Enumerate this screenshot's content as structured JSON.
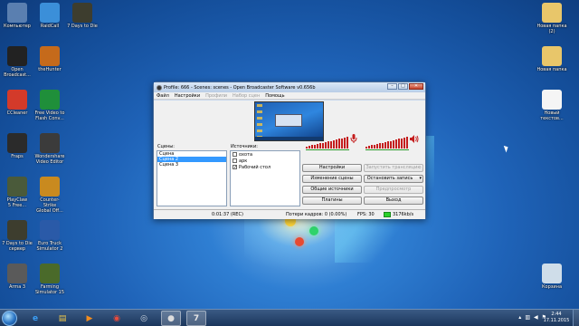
{
  "desktop": {
    "left_icons": [
      {
        "label": "Компьютер",
        "icon": "computer-icon",
        "color": "#5a7fb0"
      },
      {
        "label": "RaidCall",
        "icon": "raidcall-icon",
        "color": "#3b8fd9"
      },
      {
        "label": "7 Days to Die",
        "icon": "7days-icon",
        "color": "#3d3d2e"
      },
      {
        "label": "Open\nBroadcast...",
        "icon": "obs-icon",
        "color": "#222222"
      },
      {
        "label": "theHunter",
        "icon": "thehunter-icon",
        "color": "#c56a1b"
      },
      {
        "label": "CCleaner",
        "icon": "ccleaner-icon",
        "color": "#d33a2a"
      },
      {
        "label": "Free Video to\nFlash Conv...",
        "icon": "flash-converter-icon",
        "color": "#1f8f3a"
      },
      {
        "label": "Fraps",
        "icon": "fraps-icon",
        "color": "#2b2b2b"
      },
      {
        "label": "Wondershare\nVideo Editor",
        "icon": "wondershare-icon",
        "color": "#3b3b3b"
      },
      {
        "label": "PlayClaw\n5 Free...",
        "icon": "playclaw-icon",
        "color": "#4a5a3a"
      },
      {
        "label": "Counter-Strike\nGlobal Off...",
        "icon": "csgo-icon",
        "color": "#c98a1f"
      },
      {
        "label": "7 Days to Die\nсервер",
        "icon": "7days-server-icon",
        "color": "#3d3d2e"
      },
      {
        "label": "Euro Truck\nSimulator 2",
        "icon": "euro-truck-icon",
        "color": "#2a5aa8"
      },
      {
        "label": "Arma 3",
        "icon": "arma3-icon",
        "color": "#5a5a5a"
      },
      {
        "label": "Farming\nSimulator 15",
        "icon": "farming-icon",
        "color": "#4a6a2a"
      }
    ],
    "right_icons": [
      {
        "label": "Новая папка\n(2)",
        "icon": "folder-icon",
        "color": "#e8c66a"
      },
      {
        "label": "Новая папка",
        "icon": "folder-icon",
        "color": "#e8c66a"
      },
      {
        "label": "Новый\nтекстов...",
        "icon": "text-document-icon",
        "color": "#f5f5f5"
      },
      {
        "label": "Корзина",
        "icon": "recycle-bin-icon",
        "color": "#cfdde9"
      }
    ]
  },
  "window": {
    "title": "Profile: 666 - Scenes: scenes - Open Broadcaster Software v0.656b",
    "menu": [
      {
        "label": "Файл",
        "enabled": true
      },
      {
        "label": "Настройки",
        "enabled": true
      },
      {
        "label": "Профили",
        "enabled": false
      },
      {
        "label": "Набор сцен",
        "enabled": false
      },
      {
        "label": "Помощь",
        "enabled": true
      }
    ],
    "scenes_label": "Сцены:",
    "scenes": [
      "Сцена",
      "Сцена 2",
      "Сцена 3"
    ],
    "selected_scene": "Сцена 2",
    "sources_label": "Источники:",
    "sources": [
      {
        "label": "охота",
        "checked": false
      },
      {
        "label": "арк",
        "checked": false
      },
      {
        "label": "Рабочий стол",
        "checked": true
      }
    ],
    "buttons": {
      "settings": "Настройки",
      "start_stream": "Запустить трансляцию",
      "edit_scene": "Изменение сцены",
      "stop_recording": "Остановить запись",
      "global_sources": "Общие источники",
      "preview": "Предпросмотр",
      "plugins": "Плагины",
      "exit": "Выход"
    },
    "status": {
      "time": "0:01:37 (REC)",
      "dropped": "Потери кадров: 0 (0.00%)",
      "fps": "FPS: 30",
      "bitrate": "3176kb/s",
      "status_color": "#2ad12a"
    },
    "meter_levels": {
      "left": [
        0.15,
        0.2,
        0.25,
        0.3,
        0.35,
        0.4,
        0.45,
        0.5,
        0.55,
        0.6,
        0.65,
        0.7,
        0.75,
        0.8,
        0.85,
        0.9
      ],
      "right": [
        0.15,
        0.2,
        0.25,
        0.3,
        0.35,
        0.4,
        0.45,
        0.5,
        0.55,
        0.6,
        0.65,
        0.7,
        0.75,
        0.8,
        0.85,
        0.9
      ]
    }
  },
  "taskbar": {
    "apps": [
      {
        "icon": "ie-icon",
        "glyph": "e",
        "color": "#3a9ef5",
        "active": false
      },
      {
        "icon": "explorer-icon",
        "glyph": "▤",
        "color": "#f1c94a",
        "active": false
      },
      {
        "icon": "media-player-icon",
        "glyph": "▶",
        "color": "#f28c1e",
        "active": false
      },
      {
        "icon": "chrome-icon",
        "glyph": "◉",
        "color": "#e94b3c",
        "active": false
      },
      {
        "icon": "steam-icon",
        "glyph": "◎",
        "color": "#cfd8e3",
        "active": false
      },
      {
        "icon": "obs-taskbar-icon",
        "glyph": "●",
        "color": "#dddddd",
        "active": true
      },
      {
        "icon": "7days-taskbar-icon",
        "glyph": "7",
        "color": "#e6e6e6",
        "active": true
      }
    ],
    "clock_time": "2:44",
    "clock_date": "17.11.2015"
  }
}
